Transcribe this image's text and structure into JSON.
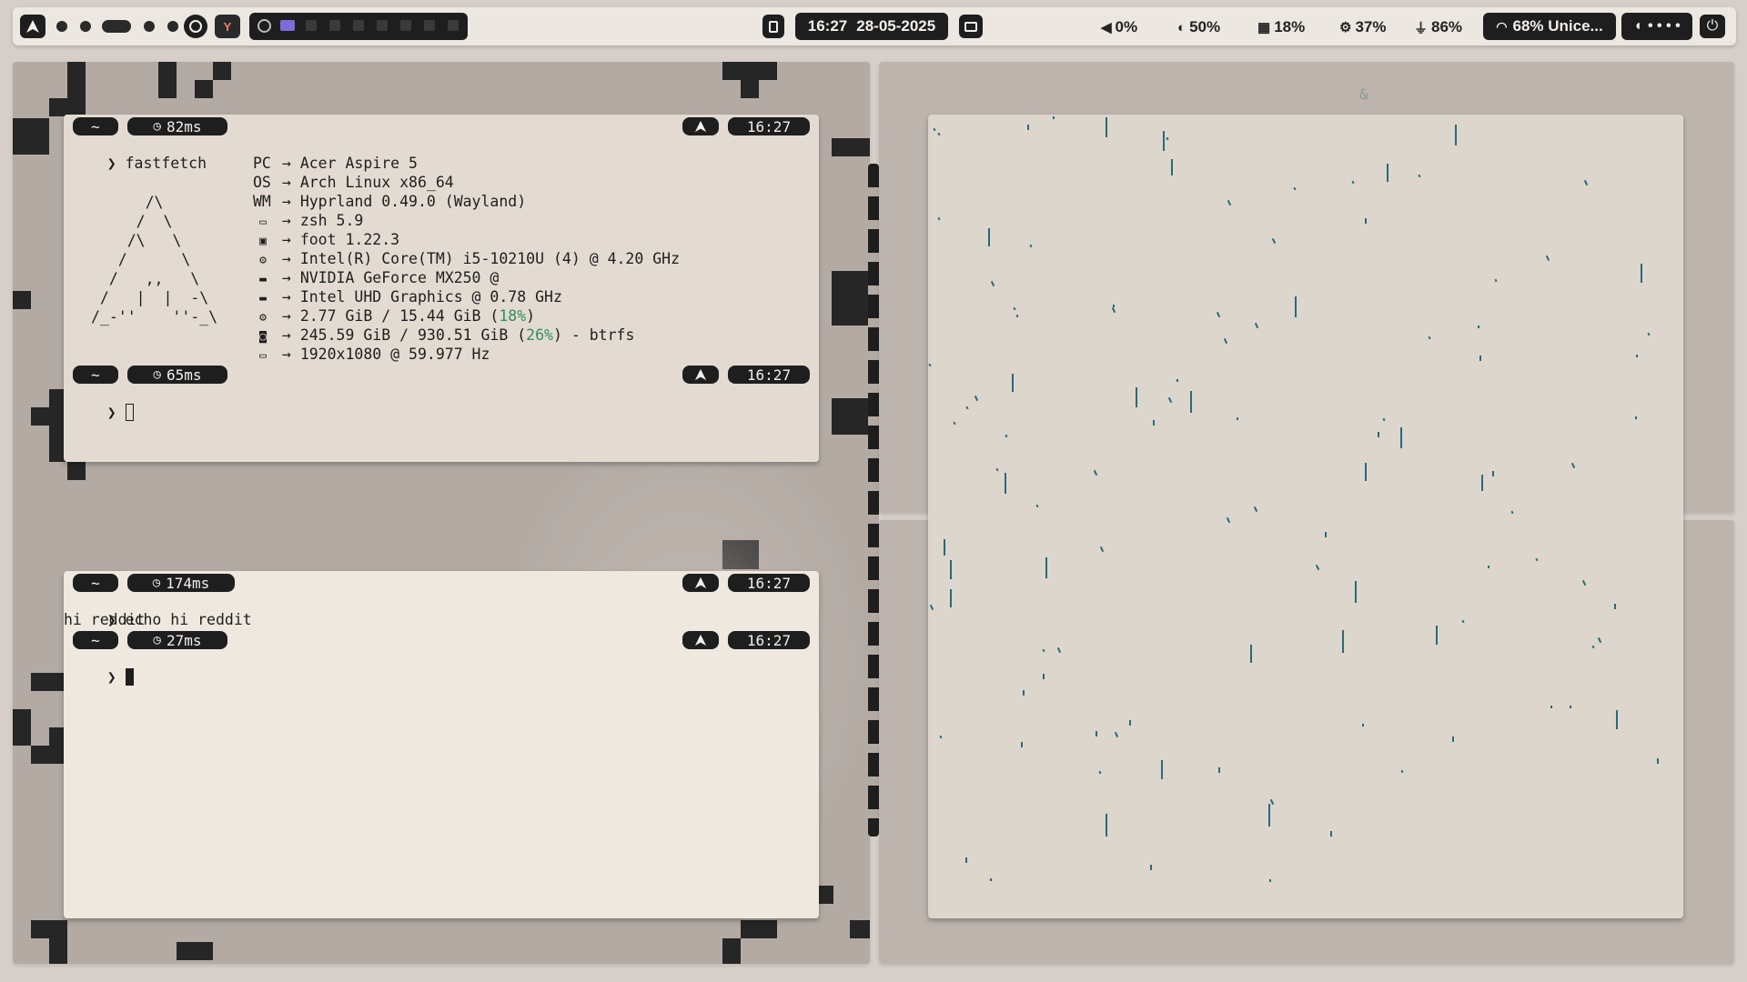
{
  "topbar": {
    "clock": "16:27",
    "date": "28-05-2025",
    "volume": "0%",
    "brightness": "50%",
    "memory": "18%",
    "cpu": "37%",
    "battery": "86%",
    "wifi": "68% Unice...",
    "media_dots": "• • • •"
  },
  "terminal1": {
    "prompt1": {
      "dir": "~",
      "duration": "82ms",
      "time": "16:27"
    },
    "command": "fastfetch",
    "info": [
      {
        "icon": "PC",
        "text": "Acer Aspire 5"
      },
      {
        "icon": "OS",
        "text": "Arch Linux x86_64"
      },
      {
        "icon": "WM",
        "text": "Hyprland 0.49.0 (Wayland)"
      },
      {
        "icon": "shell-icon",
        "text": "zsh 5.9"
      },
      {
        "icon": "terminal-icon",
        "text": "foot 1.22.3"
      },
      {
        "icon": "cpu-icon",
        "text": "Intel(R) Core(TM) i5-10210U (4) @ 4.20 GHz"
      },
      {
        "icon": "gpu-icon",
        "text": "NVIDIA GeForce MX250 @"
      },
      {
        "icon": "gpu-icon",
        "text": "Intel UHD Graphics @ 0.78 GHz"
      },
      {
        "icon": "memory-icon",
        "text_a": "2.77 GiB / 15.44 GiB (",
        "text_pct": "18%",
        "text_b": ")"
      },
      {
        "icon": "disk-icon",
        "text_a": "245.59 GiB / 930.51 GiB (",
        "text_pct": "26%",
        "text_b": ") - btrfs"
      },
      {
        "icon": "display-icon",
        "text": "1920x1080 @ 59.977 Hz"
      }
    ],
    "arrow": "→",
    "logo": [
      "      /\\",
      "     /  \\",
      "    /\\   \\",
      "   /      \\",
      "  /   ,,   \\",
      " /   |  |  -\\",
      "/_-''    ''-_\\"
    ],
    "prompt2": {
      "dir": "~",
      "duration": "65ms",
      "time": "16:27"
    }
  },
  "terminal2": {
    "prompt1": {
      "dir": "~",
      "duration": "174ms",
      "time": "16:27"
    },
    "command": "echo hi reddit",
    "output": "hi reddit",
    "prompt2": {
      "dir": "~",
      "duration": "27ms",
      "time": "16:27"
    }
  },
  "colors": {
    "accent_green": "#2f8f5e",
    "rain": "#2a6a7a",
    "bar_bg": "#ede7e1",
    "terminal2_bg": "#efe8df"
  }
}
